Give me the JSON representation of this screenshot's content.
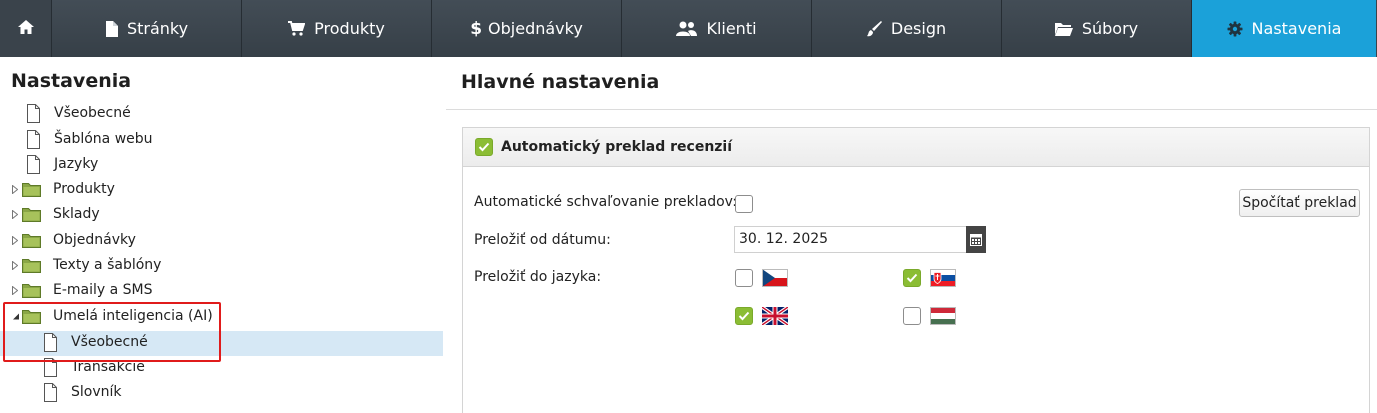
{
  "nav": {
    "home_icon": "home-icon",
    "tabs": [
      {
        "label": "Stránky",
        "icon": "page-icon"
      },
      {
        "label": "Produkty",
        "icon": "cart-icon"
      },
      {
        "label": "Objednávky",
        "icon": "dollar-icon"
      },
      {
        "label": "Klienti",
        "icon": "users-icon"
      },
      {
        "label": "Design",
        "icon": "brush-icon"
      },
      {
        "label": "Súbory",
        "icon": "folder-icon"
      },
      {
        "label": "Nastavenia",
        "icon": "gear-icon",
        "active": true
      }
    ],
    "active_color": "#1ba1d9"
  },
  "sidebar": {
    "title": "Nastavenia",
    "items": [
      {
        "label": "Všeobecné",
        "type": "page"
      },
      {
        "label": "Šablóna webu",
        "type": "page"
      },
      {
        "label": "Jazyky",
        "type": "page"
      },
      {
        "label": "Produkty",
        "type": "folder",
        "expanded": false
      },
      {
        "label": "Sklady",
        "type": "folder",
        "expanded": false
      },
      {
        "label": "Objednávky",
        "type": "folder",
        "expanded": false
      },
      {
        "label": "Texty a šablóny",
        "type": "folder",
        "expanded": false
      },
      {
        "label": "E-maily a SMS",
        "type": "folder",
        "expanded": false
      },
      {
        "label": "Umelá inteligencia (AI)",
        "type": "folder",
        "expanded": true
      },
      {
        "label": "Všeobecné",
        "type": "page",
        "selected": true
      },
      {
        "label": "Transakcie",
        "type": "page"
      },
      {
        "label": "Slovník",
        "type": "page"
      }
    ]
  },
  "main": {
    "title": "Hlavné nastavenia",
    "panel": {
      "title": "Automatický preklad recenzií",
      "enabled": true,
      "auto_approve_label": "Automatické schvaľovanie prekladov:",
      "auto_approve": false,
      "calc_button": "Spočítať preklad",
      "date_label": "Preložiť od dátumu:",
      "date_value": "30. 12. 2025",
      "lang_label": "Preložiť do jazyka:",
      "languages": [
        {
          "code": "cz",
          "checked": false
        },
        {
          "code": "sk",
          "checked": true
        },
        {
          "code": "gb",
          "checked": true
        },
        {
          "code": "hu",
          "checked": false
        }
      ]
    },
    "check_color": "#8bbd34"
  }
}
